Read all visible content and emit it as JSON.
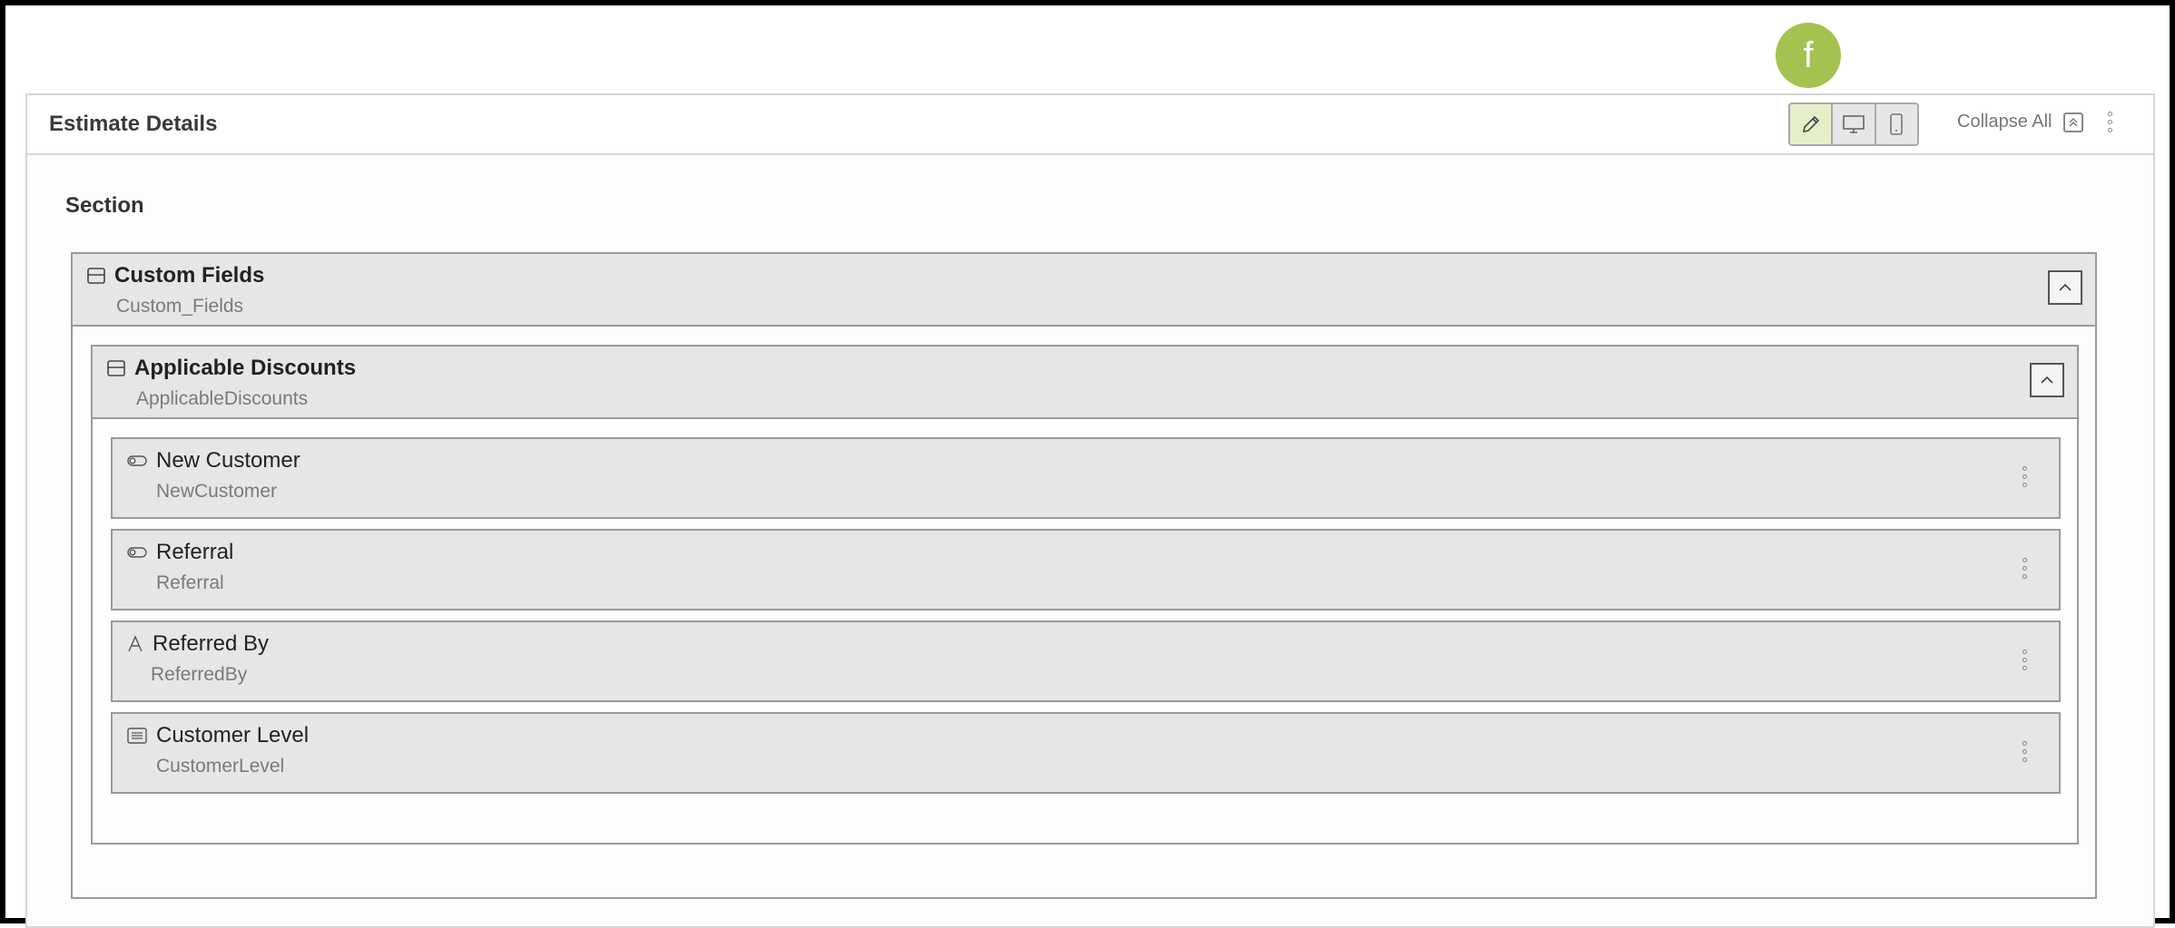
{
  "avatar": {
    "initial": "f",
    "color": "#a4c24f"
  },
  "panel": {
    "title": "Estimate Details",
    "collapse_all_label": "Collapse All",
    "view_modes": [
      "edit-icon",
      "desktop-icon",
      "mobile-icon"
    ],
    "active_view_mode": "edit"
  },
  "section": {
    "label": "Section"
  },
  "custom_fields": {
    "title": "Custom Fields",
    "api_name": "Custom_Fields",
    "icon": "section-icon"
  },
  "applicable_discounts": {
    "title": "Applicable Discounts",
    "api_name": "ApplicableDiscounts",
    "icon": "section-icon"
  },
  "fields": [
    {
      "label": "New Customer",
      "api_name": "NewCustomer",
      "icon": "toggle-icon"
    },
    {
      "label": "Referral",
      "api_name": "Referral",
      "icon": "toggle-icon"
    },
    {
      "label": "Referred By",
      "api_name": "ReferredBy",
      "icon": "text-icon"
    },
    {
      "label": "Customer Level",
      "api_name": "CustomerLevel",
      "icon": "list-icon"
    }
  ]
}
